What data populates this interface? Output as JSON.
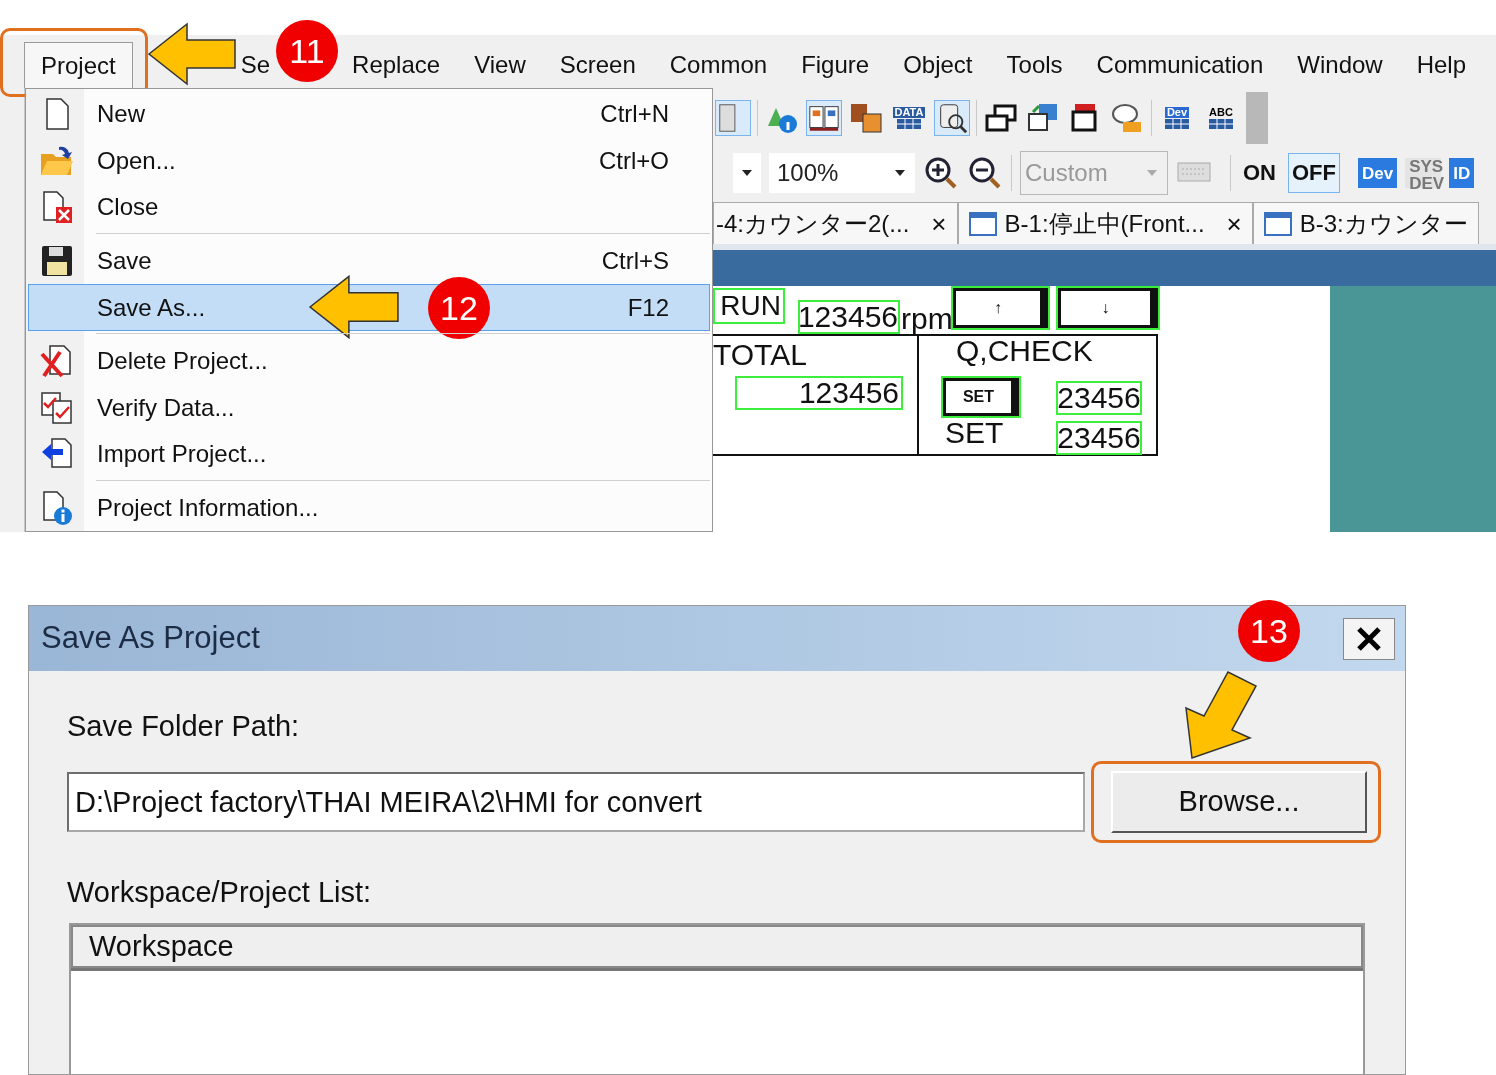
{
  "menu_bar": {
    "items": [
      {
        "label": "Project",
        "selected": true
      },
      {
        "label": "Se",
        "selected": false
      },
      {
        "label": "Replace",
        "selected": false
      },
      {
        "label": "View",
        "selected": false
      },
      {
        "label": "Screen",
        "selected": false
      },
      {
        "label": "Common",
        "selected": false
      },
      {
        "label": "Figure",
        "selected": false
      },
      {
        "label": "Object",
        "selected": false
      },
      {
        "label": "Tools",
        "selected": false
      },
      {
        "label": "Communication",
        "selected": false
      },
      {
        "label": "Window",
        "selected": false
      },
      {
        "label": "Help",
        "selected": false
      }
    ]
  },
  "project_menu": {
    "items": [
      {
        "label": "New",
        "shortcut": "Ctrl+N",
        "selected": false,
        "separator_before": false
      },
      {
        "label": "Open...",
        "shortcut": "Ctrl+O",
        "selected": false,
        "separator_before": false
      },
      {
        "label": "Close",
        "selected": false,
        "separator_before": false
      },
      {
        "label": "Save",
        "shortcut": "Ctrl+S",
        "selected": false,
        "separator_before": true
      },
      {
        "label": "Save As...",
        "shortcut": "F12",
        "selected": true,
        "separator_before": false
      },
      {
        "label": "Delete Project...",
        "selected": false,
        "separator_before": true
      },
      {
        "label": "Verify Data...",
        "selected": false,
        "separator_before": false
      },
      {
        "label": "Import Project...",
        "selected": false,
        "separator_before": false
      },
      {
        "label": "Project Information...",
        "selected": false,
        "separator_before": true
      }
    ]
  },
  "toolbar": {
    "icon_labels": [
      "DATA",
      "Dev",
      "ABC"
    ],
    "zoom": "100%",
    "screen_size": "Custom",
    "buttons": [
      {
        "label": "ON",
        "selected": false,
        "disabled": false
      },
      {
        "label": "OFF",
        "selected": true,
        "disabled": false
      },
      {
        "label": "Dev",
        "selected": false,
        "disabled": false
      },
      {
        "label": "SYS DEV",
        "selected": false,
        "disabled": true
      },
      {
        "label": "ID",
        "selected": false,
        "disabled": false
      }
    ]
  },
  "tabs": [
    {
      "label": "-4:カウンター2(...",
      "close": "×"
    },
    {
      "label": "B-1:停止中(Front...",
      "close": "×"
    },
    {
      "label": "B-3:カウンター"
    }
  ],
  "canvas": {
    "items": [
      {
        "kind": "label",
        "text": "RUN"
      },
      {
        "kind": "numeric",
        "text": "123456"
      },
      {
        "kind": "text",
        "text": "rpm"
      },
      {
        "kind": "switch",
        "text": "↑"
      },
      {
        "kind": "switch",
        "text": "↓"
      },
      {
        "kind": "text",
        "text": "TOTAL"
      },
      {
        "kind": "numeric",
        "text": "123456"
      },
      {
        "kind": "text",
        "text": "Q,CHECK"
      },
      {
        "kind": "switch",
        "text": "SET"
      },
      {
        "kind": "text",
        "text": "SET"
      },
      {
        "kind": "numeric",
        "text": "23456"
      },
      {
        "kind": "numeric",
        "text": "23456"
      }
    ]
  },
  "dialog": {
    "title": "Save As Project",
    "path_label": "Save Folder Path:",
    "path_value": "D:\\Project factory\\THAI MEIRA\\2\\HMI for convert",
    "browse_button": "Browse...",
    "list_label": "Workspace/Project List:",
    "list_columns": [
      "Workspace"
    ]
  },
  "annotations": [
    {
      "label": "11"
    },
    {
      "label": "12"
    },
    {
      "label": "13"
    }
  ]
}
